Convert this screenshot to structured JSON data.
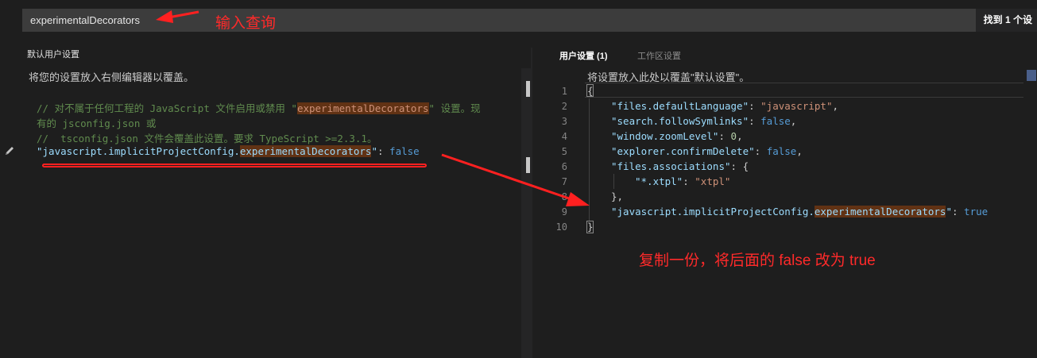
{
  "search": {
    "value": "experimentalDecorators",
    "result_count": "找到 1 个设"
  },
  "annotations": {
    "query": "输入查询",
    "copy": "复制一份，将后面的 false 改为 true"
  },
  "left_panel": {
    "title": "默认用户设置",
    "description": "将您的设置放入右侧编辑器以覆盖。",
    "comment_line1_a": "// 对不属于任何工程的 JavaScript 文件启用或禁用 \"",
    "comment_line1_hl": "experimentalDecorators",
    "comment_line1_b": "\" 设置。现",
    "comment_line2": "有的 jsconfig.json 或",
    "comment_line3": "//  tsconfig.json 文件会覆盖此设置。要求 TypeScript >=2.3.1。",
    "setting_key_a": "\"javascript.implicitProjectConfig.",
    "setting_key_hl": "experimentalDecorators",
    "setting_key_b": "\"",
    "setting_colon": ": ",
    "setting_value": "false"
  },
  "right_panel": {
    "tab_user": "用户设置 (1)",
    "tab_workspace": "工作区设置",
    "description": "将设置放入此处以覆盖\"默认设置\"。",
    "line_numbers": [
      "1",
      "2",
      "3",
      "4",
      "5",
      "6",
      "7",
      "8",
      "9",
      "10"
    ],
    "lines": {
      "l1": "{",
      "l2_key": "\"files.defaultLanguage\"",
      "l2_val": "\"javascript\"",
      "l3_key": "\"search.followSymlinks\"",
      "l3_val": "false",
      "l4_key": "\"window.zoomLevel\"",
      "l4_val": "0",
      "l5_key": "\"explorer.confirmDelete\"",
      "l5_val": "false",
      "l6_key": "\"files.associations\"",
      "l6_rest": ": {",
      "l7_key": "\"*.xtpl\"",
      "l7_val": "\"xtpl\"",
      "l8": "},",
      "l9_key_a": "\"javascript.implicitProjectConfig.",
      "l9_key_hl": "experimentalDecorators",
      "l9_key_b": "\"",
      "l9_val": "true",
      "l10": "}"
    }
  },
  "colors": {
    "annotation": "#ff2a2a",
    "comment": "#608b4e",
    "string": "#ce9178",
    "keyword": "#569cd6",
    "highlight": "#613214"
  },
  "icons": {
    "edit": "pencil-icon"
  }
}
